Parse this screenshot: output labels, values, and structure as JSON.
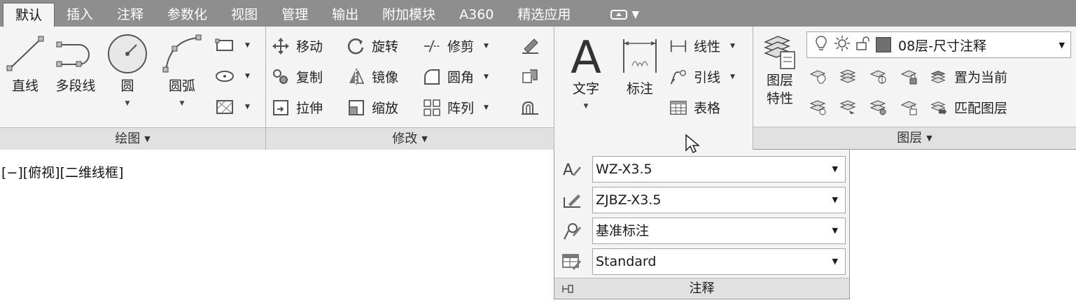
{
  "tabs": [
    "默认",
    "插入",
    "注释",
    "参数化",
    "视图",
    "管理",
    "输出",
    "附加模块",
    "A360",
    "精选应用"
  ],
  "draw_panel": {
    "title": "绘图",
    "tools": [
      "直线",
      "多段线",
      "圆",
      "圆弧"
    ]
  },
  "modify_panel": {
    "title": "修改",
    "col1": [
      "移动",
      "复制",
      "拉伸"
    ],
    "col2": [
      "旋转",
      "镜像",
      "缩放"
    ],
    "col3": [
      "修剪",
      "圆角",
      "阵列"
    ]
  },
  "annotation_panel": {
    "text_label": "文字",
    "dim_label": "标注",
    "linear": "线性",
    "leader": "引线",
    "table": "表格"
  },
  "layers_panel": {
    "title": "图层",
    "props_line1": "图层",
    "props_line2": "特性",
    "current_layer": "08层-尺寸注释",
    "layer_color": "#6f6f6f",
    "set_current": "置为当前",
    "match_layer": "匹配图层"
  },
  "viewport_label": "[−][俯视][二维线框]",
  "annotation_dropdown": {
    "text_style": "WZ-X3.5",
    "dim_style": "ZJBZ-X3.5",
    "multileader_style": "基准标注",
    "table_style": "Standard",
    "footer": "注释"
  }
}
